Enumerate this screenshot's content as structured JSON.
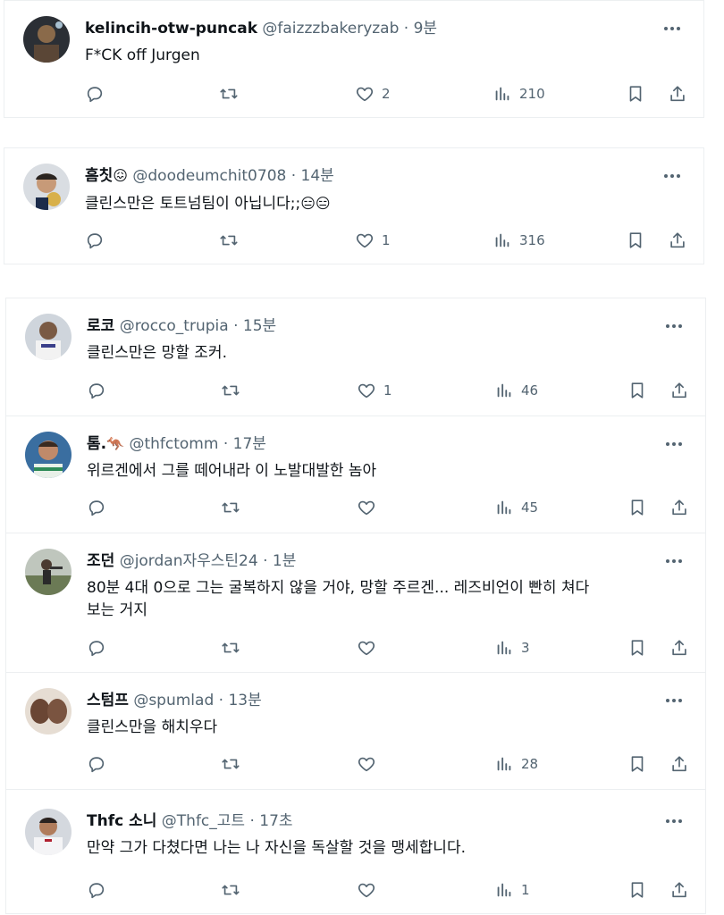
{
  "tweets": [
    {
      "name": "kelincih-otw-puncak",
      "badge": "",
      "handle": "@faizzzbakeryzab",
      "dot": "·",
      "time": "9분",
      "text": "F*CK off Jurgen",
      "emoji": "",
      "replies": "",
      "retweets": "",
      "likes": "2",
      "views": "210"
    },
    {
      "name": "흠칫",
      "badge": "😖",
      "handle": "@doodeumchit0708",
      "dot": "·",
      "time": "14분",
      "text": "클린스만은 토트넘팀이 아닙니다;;",
      "emoji": "😑😑",
      "replies": "",
      "retweets": "",
      "likes": "1",
      "views": "316"
    },
    {
      "name": "로코",
      "badge": "",
      "handle": "@rocco_trupia",
      "dot": "·",
      "time": "15분",
      "text": "클린스만은 망할 조커.",
      "emoji": "",
      "replies": "",
      "retweets": "",
      "likes": "1",
      "views": "46"
    },
    {
      "name": "톰.",
      "badge": "🦘",
      "handle": "@thfctomm",
      "dot": "·",
      "time": "17분",
      "text": "위르겐에서 그를 떼어내라 이 노발대발한 놈아",
      "emoji": "",
      "replies": "",
      "retweets": "",
      "likes": "",
      "views": "45"
    },
    {
      "name": "조던",
      "badge": "",
      "handle": "@jordan자우스틴24",
      "dot": "·",
      "time": "1분",
      "text": "80분 4대 0으로 그는 굴복하지 않을 거야, 망할 주르겐... 레즈비언이 빤히 쳐다\n보는 거지",
      "emoji": "",
      "replies": "",
      "retweets": "",
      "likes": "",
      "views": "3"
    },
    {
      "name": "스텀프",
      "badge": "",
      "handle": "@spumlad",
      "dot": "·",
      "time": "13분",
      "text": "클린스만을 해치우다",
      "emoji": "",
      "replies": "",
      "retweets": "",
      "likes": "",
      "views": "28"
    },
    {
      "name": "Thfc 소니",
      "badge": "",
      "handle": "@Thfc_고트",
      "dot": "·",
      "time": "17초",
      "text": "만약 그가 다쳤다면 나는 나 자신을 독살할 것을 맹세합니다.",
      "emoji": "",
      "replies": "",
      "retweets": "",
      "likes": "",
      "views": "1"
    }
  ]
}
